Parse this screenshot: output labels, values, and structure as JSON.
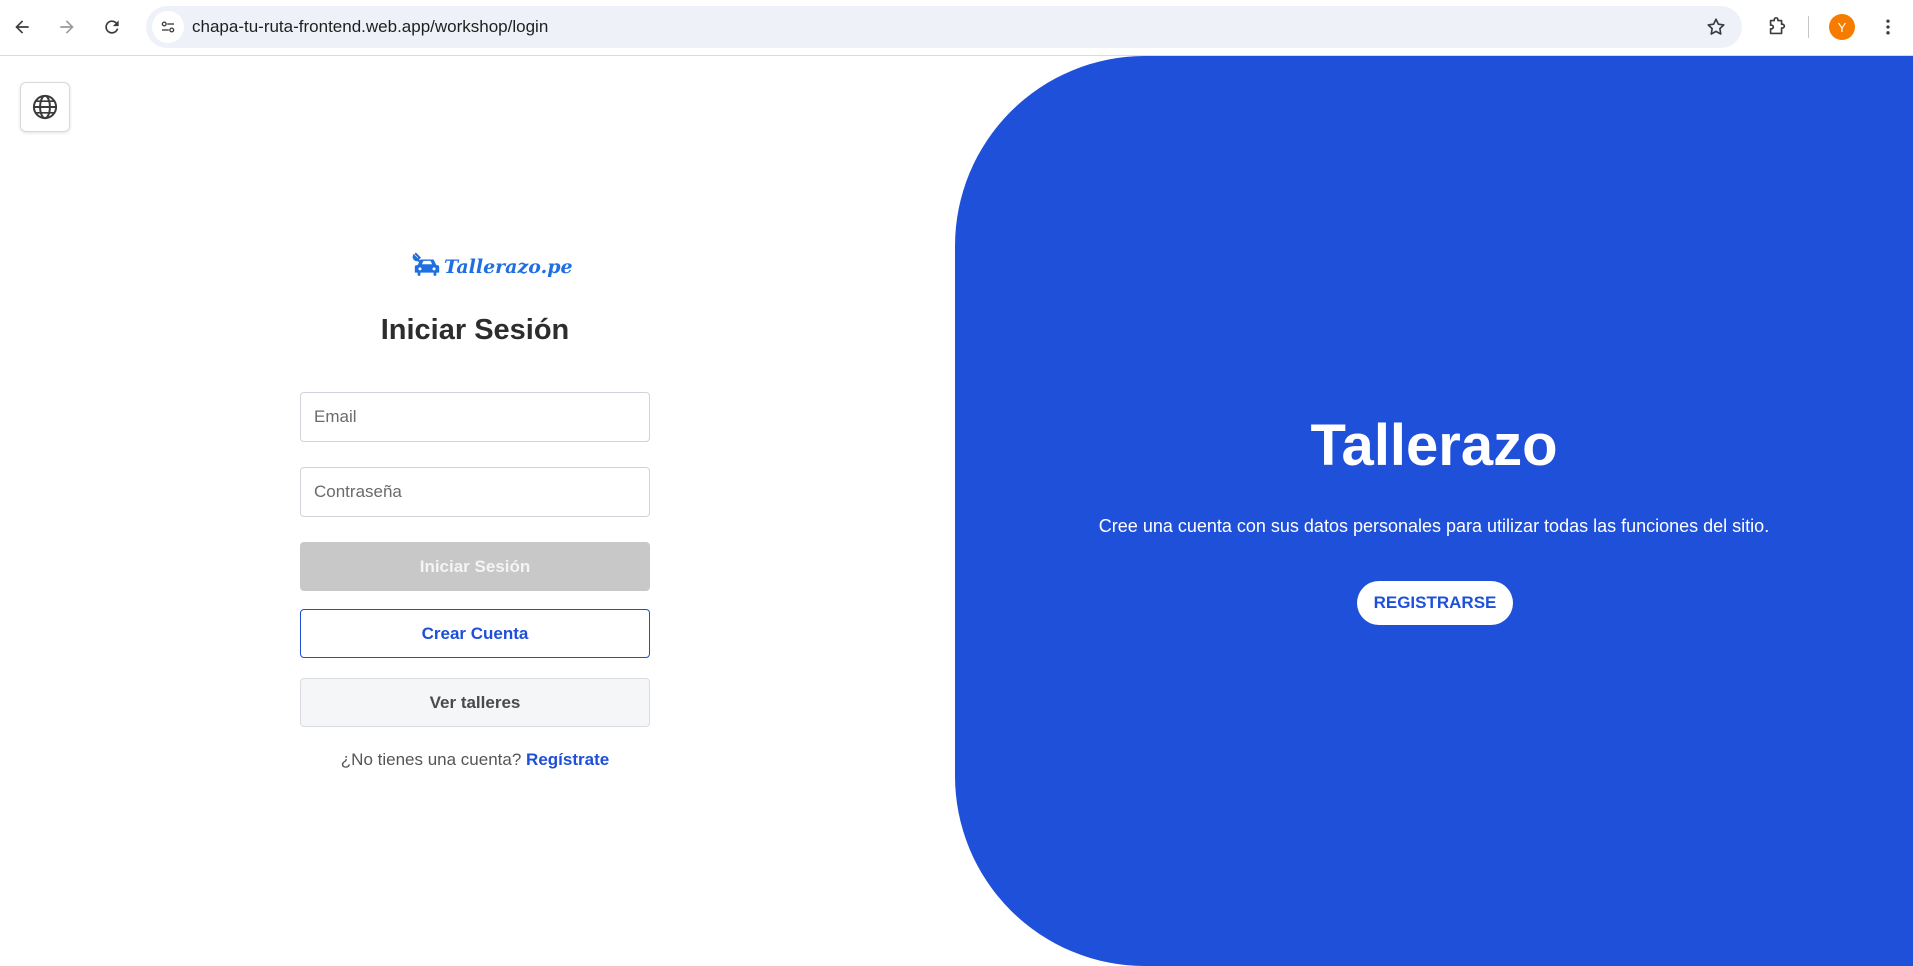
{
  "browser": {
    "url": "chapa-tu-ruta-frontend.web.app/workshop/login",
    "profile_initial": "Y",
    "icons": [
      "back-arrow-icon",
      "forward-arrow-icon",
      "reload-icon",
      "site-settings-icon",
      "bookmark-star-icon",
      "extensions-puzzle-icon",
      "kebab-menu-icon"
    ]
  },
  "page": {
    "language_icon": "globe-icon",
    "brand": {
      "name": "Tallerazo.pe",
      "icon": "car-wrench-icon"
    },
    "login": {
      "title": "Iniciar Sesión",
      "email_placeholder": "Email",
      "password_placeholder": "Contraseña",
      "login_button": "Iniciar Sesión",
      "create_account_button": "Crear Cuenta",
      "view_workshops_button": "Ver talleres",
      "no_account_text": "¿No tienes una cuenta?",
      "register_link": "Regístrate"
    },
    "panel": {
      "title": "Tallerazo",
      "description": "Cree una cuenta con sus datos personales para utilizar todas las funciones del sitio.",
      "register_button": "REGISTRARSE"
    }
  },
  "colors": {
    "primary_blue": "#1f50d9",
    "brand_blue": "#1f6fe0",
    "disabled_button": "#c8c8c8",
    "avatar_orange": "#f57c00"
  }
}
